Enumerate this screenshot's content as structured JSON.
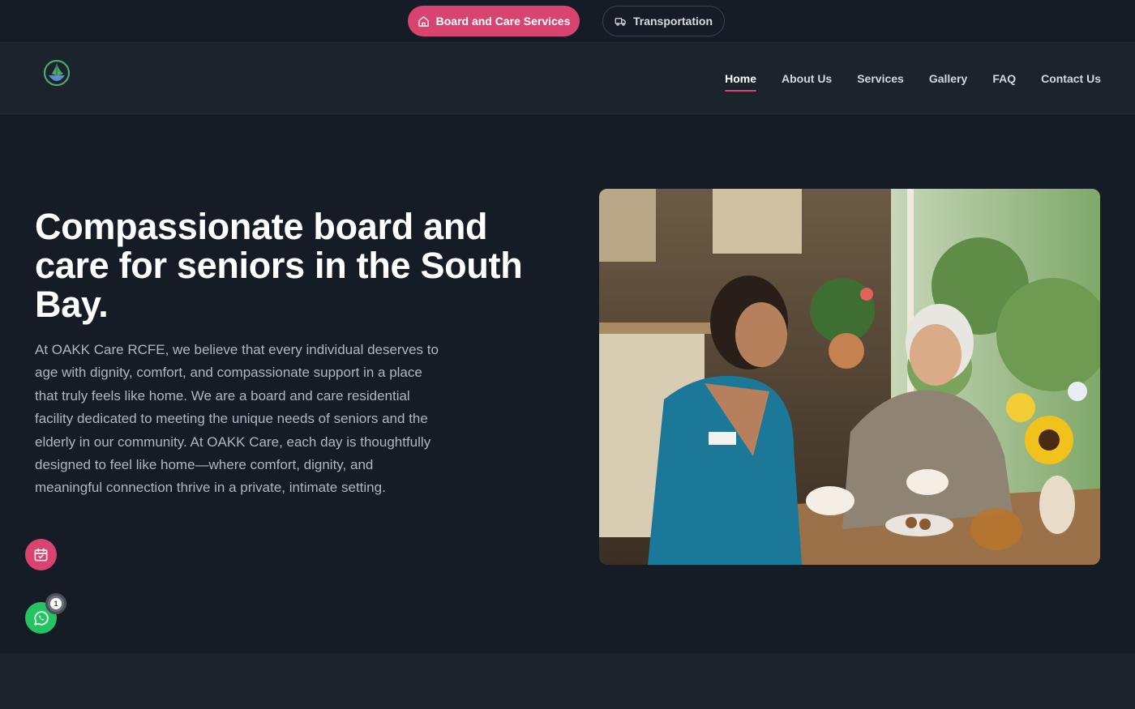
{
  "topbar": {
    "board_care_label": "Board and Care Services",
    "transportation_label": "Transportation"
  },
  "nav": {
    "items": [
      "Home",
      "About Us",
      "Services",
      "Gallery",
      "FAQ",
      "Contact Us"
    ],
    "active": "Home"
  },
  "hero": {
    "title": "Compassionate board and care for seniors in the South Bay.",
    "body": "At OAKK Care RCFE, we believe that every individual deserves to age with dignity, comfort, and compassionate support in a place that truly feels like home. We are a board and care residential facility dedicated to meeting the unique needs of seniors and the elderly in our community. At OAKK Care, each day is thoughtfully designed to feel like home—where comfort, dignity, and meaningful connection thrive in a private, intimate setting."
  },
  "floating": {
    "whatsapp_badge": "1"
  },
  "colors": {
    "accent": "#d8446f",
    "background": "#161c26",
    "header": "#1b232d",
    "whatsapp": "#25c463"
  }
}
